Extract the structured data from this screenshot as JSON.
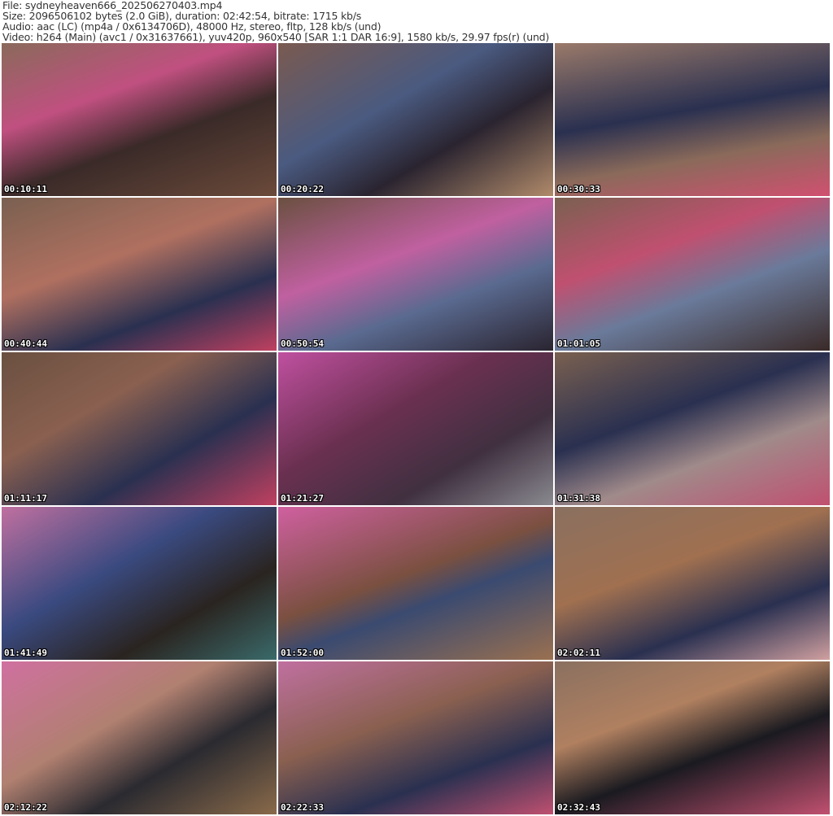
{
  "header": {
    "file": "File: sydneyheaven666_202506270403.mp4",
    "size": "Size: 2096506102 bytes (2.0 GiB), duration: 02:42:54, bitrate: 1715 kb/s",
    "audio": "Audio: aac (LC) (mp4a / 0x6134706D), 48000 Hz, stereo, fltp, 128 kb/s (und)",
    "video": "Video: h264 (Main) (avc1 / 0x31637661), yuv420p, 960x540 [SAR 1:1 DAR 16:9], 1580 kb/s, 29.97 fps(r) (und)"
  },
  "thumbnails": [
    {
      "time": "00:10:11"
    },
    {
      "time": "00:20:22"
    },
    {
      "time": "00:30:33"
    },
    {
      "time": "00:40:44"
    },
    {
      "time": "00:50:54"
    },
    {
      "time": "01:01:05"
    },
    {
      "time": "01:11:17"
    },
    {
      "time": "01:21:27"
    },
    {
      "time": "01:31:38"
    },
    {
      "time": "01:41:49"
    },
    {
      "time": "01:52:00"
    },
    {
      "time": "02:02:11"
    },
    {
      "time": "02:12:22"
    },
    {
      "time": "02:22:33"
    },
    {
      "time": "02:32:43"
    }
  ]
}
